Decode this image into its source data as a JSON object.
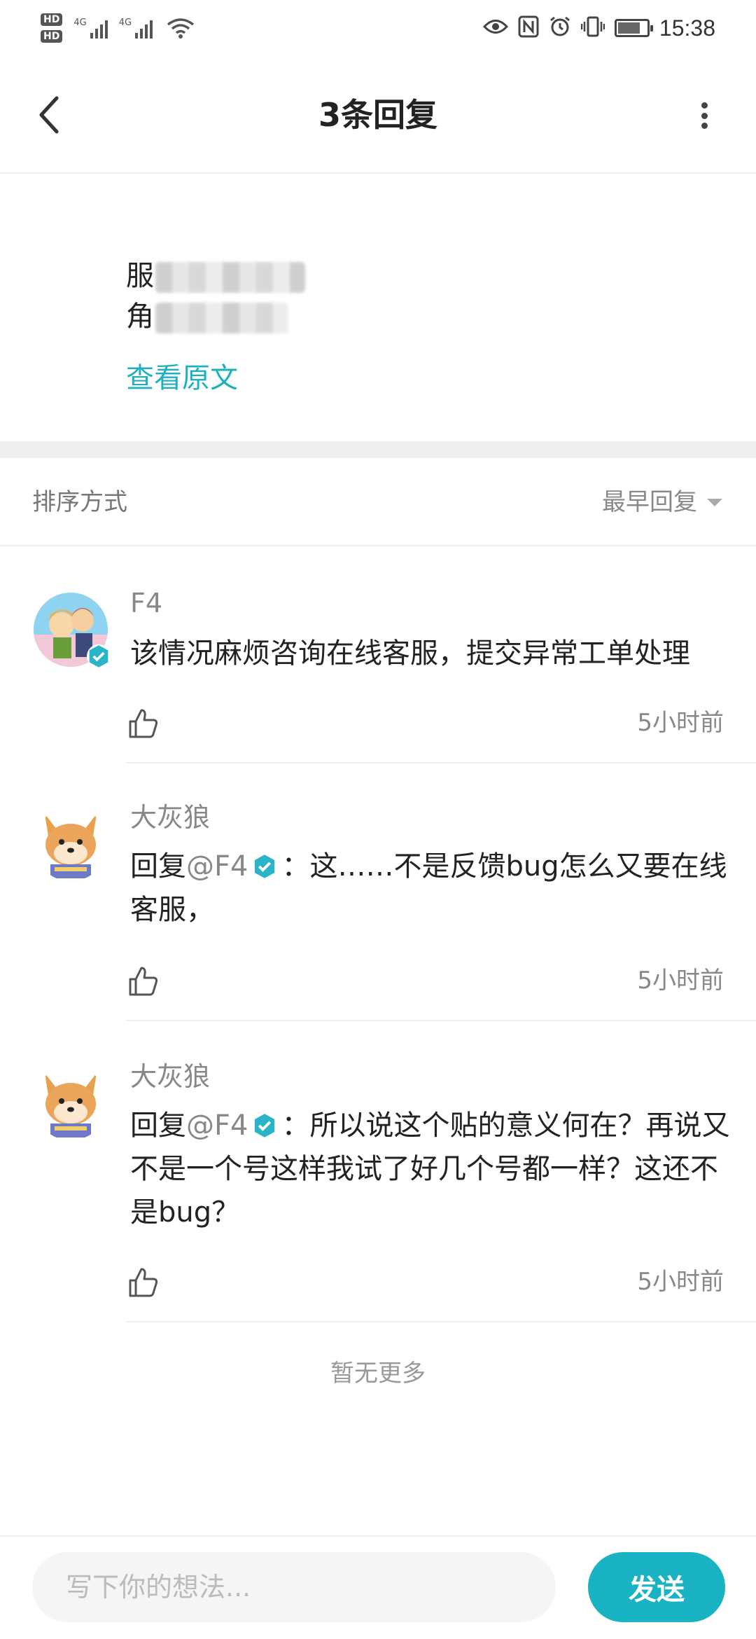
{
  "status_bar": {
    "hd1": "HD",
    "hd2": "HD",
    "net1": "4G",
    "net2": "4G",
    "time": "15:38",
    "icons": [
      "eye-icon",
      "nfc-icon",
      "alarm-icon",
      "vibrate-icon",
      "battery-icon"
    ]
  },
  "header": {
    "title": "3条回复",
    "back_icon": "chevron-left-icon",
    "more_icon": "more-vertical-icon"
  },
  "original_post": {
    "line1_visible": "服",
    "line2_visible": "角",
    "view_original_label": "查看原文"
  },
  "sort": {
    "label": "排序方式",
    "selected": "最早回复"
  },
  "replies": [
    {
      "author": "F4",
      "verified": true,
      "text": "该情况麻烦咨询在线客服，提交异常工单处理",
      "time": "5小时前"
    },
    {
      "author": "大灰狼",
      "reply_prefix": "回复",
      "mention": "@F4",
      "text": "：这……不是反馈bug怎么又要在线客服，",
      "time": "5小时前"
    },
    {
      "author": "大灰狼",
      "reply_prefix": "回复",
      "mention": "@F4",
      "text": "：所以说这个贴的意义何在？再说又不是一个号这样我试了好几个号都一样？这还不是bug？",
      "time": "5小时前"
    }
  ],
  "footer_note": "暂无更多",
  "composer": {
    "placeholder": "写下你的想法...",
    "send_label": "发送"
  },
  "colors": {
    "accent": "#19b3c4",
    "link": "#1fb0c0",
    "muted": "#888888",
    "divider": "#eeeeee"
  }
}
